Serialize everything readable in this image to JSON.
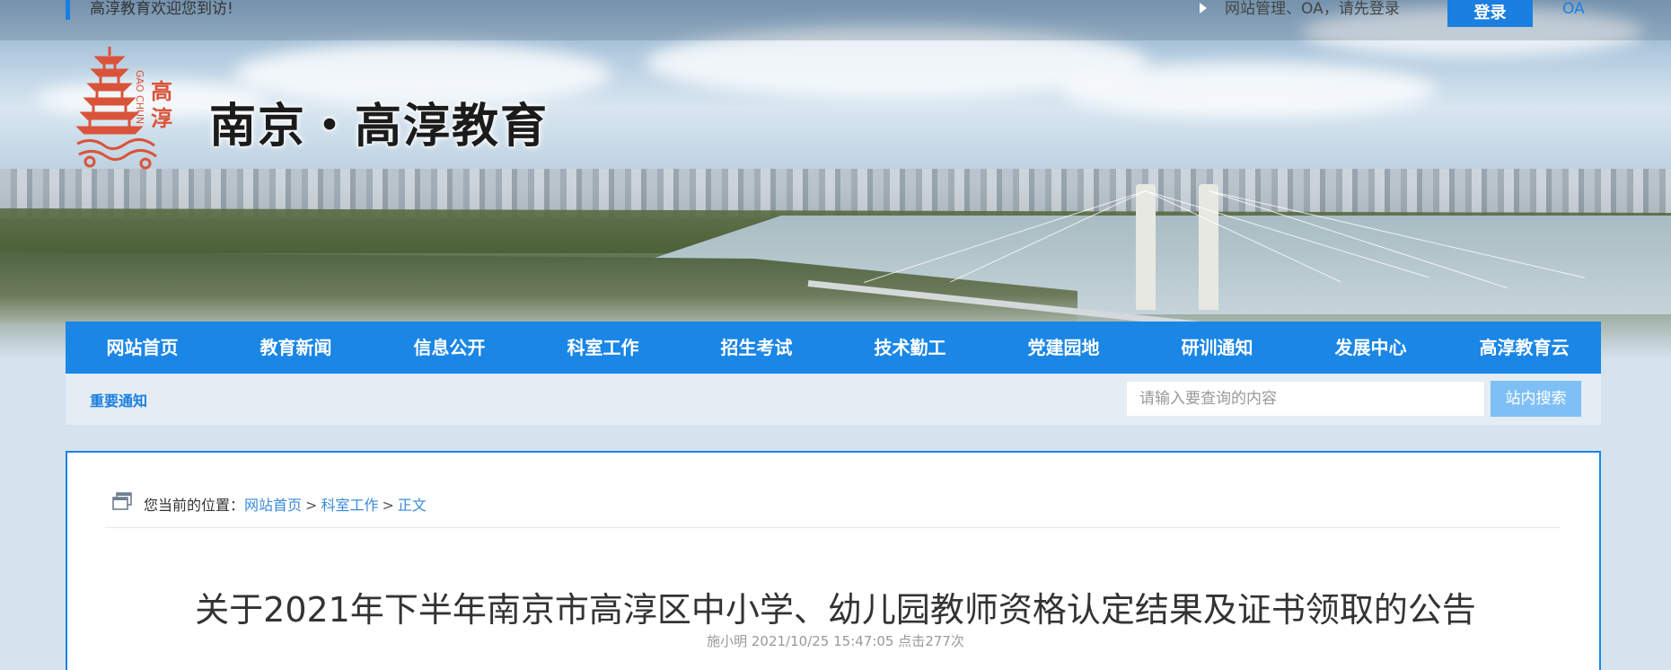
{
  "topbar": {
    "welcome": "高淳教育欢迎您到访!",
    "admin_text": "网站管理、OA，请先登录",
    "login_label": "登录",
    "oa_label": "OA"
  },
  "header": {
    "site_title": "南京・高淳教育",
    "logo": {
      "icon": "pagoda-logo-icon",
      "text_cn": "高淳",
      "text_en": "GAO CHUN"
    }
  },
  "nav": {
    "items": [
      {
        "label": "网站首页"
      },
      {
        "label": "教育新闻"
      },
      {
        "label": "信息公开"
      },
      {
        "label": "科室工作"
      },
      {
        "label": "招生考试"
      },
      {
        "label": "技术勤工"
      },
      {
        "label": "党建园地"
      },
      {
        "label": "研训通知"
      },
      {
        "label": "发展中心"
      },
      {
        "label": "高淳教育云"
      }
    ]
  },
  "subbar": {
    "notice_label": "重要通知",
    "search_placeholder": "请输入要查询的内容",
    "search_button": "站内搜索"
  },
  "breadcrumb": {
    "prefix": "您当前的位置：",
    "items": [
      "网站首页",
      "科室工作",
      "正文"
    ],
    "separator": ">"
  },
  "article": {
    "title": "关于2021年下半年南京市高淳区中小学、幼儿园教师资格认定结果及证书领取的公告",
    "meta": "施小明 2021/10/25 15:47:05 点击277次"
  },
  "colors": {
    "primary": "#1a86e6",
    "link": "#3a8ad8",
    "search_button": "#7ec0f5"
  }
}
